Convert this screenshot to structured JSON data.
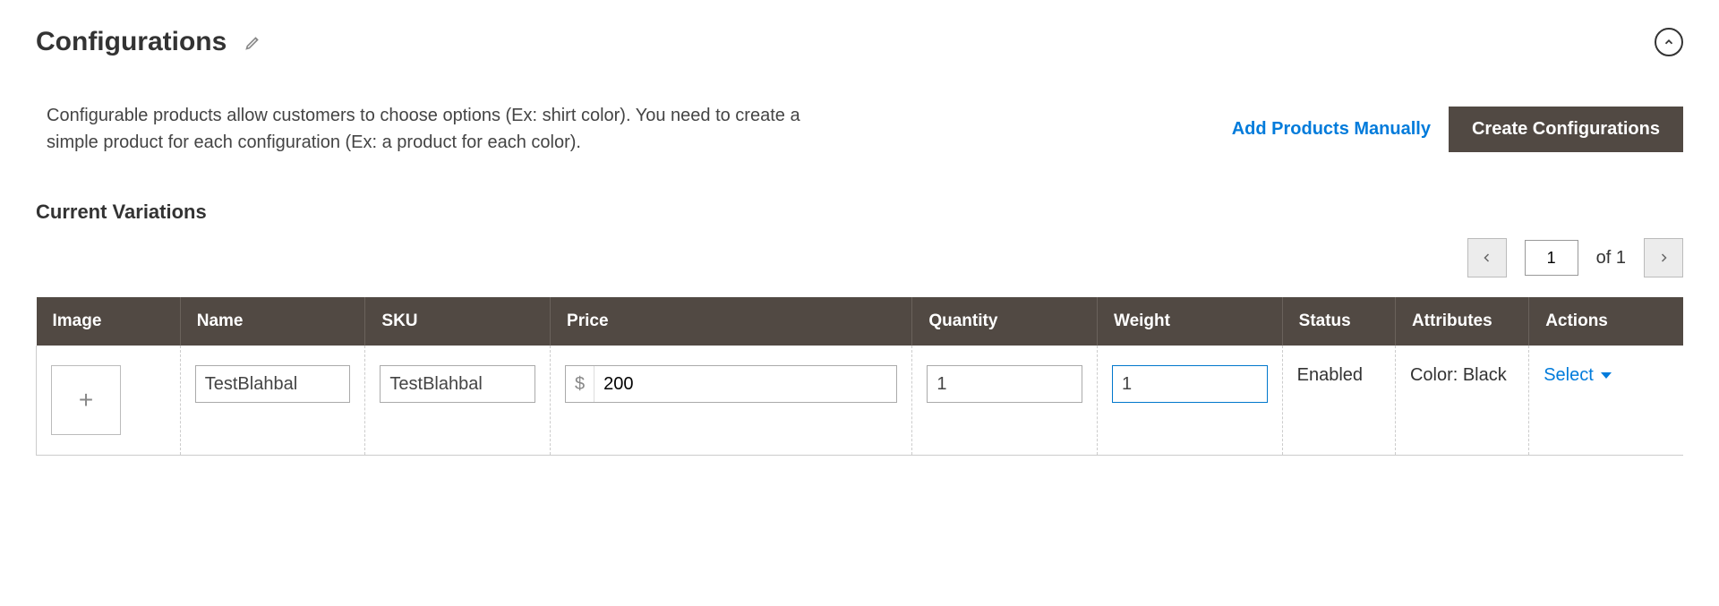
{
  "section_title": "Configurations",
  "description": "Configurable products allow customers to choose options (Ex: shirt color). You need to create a simple product for each configuration (Ex: a product for each color).",
  "actions": {
    "add_manually_label": "Add Products Manually",
    "create_config_label": "Create Configurations"
  },
  "subheading": "Current Variations",
  "pagination": {
    "current_page": "1",
    "of_label": "of 1"
  },
  "table": {
    "headers": {
      "image": "Image",
      "name": "Name",
      "sku": "SKU",
      "price": "Price",
      "quantity": "Quantity",
      "weight": "Weight",
      "status": "Status",
      "attributes": "Attributes",
      "actions": "Actions"
    },
    "currency_symbol": "$",
    "rows": [
      {
        "name": "TestBlahbal",
        "sku": "TestBlahbal",
        "price": "200",
        "quantity": "1",
        "weight": "1",
        "status": "Enabled",
        "attributes": "Color: Black",
        "action_label": "Select"
      }
    ]
  }
}
